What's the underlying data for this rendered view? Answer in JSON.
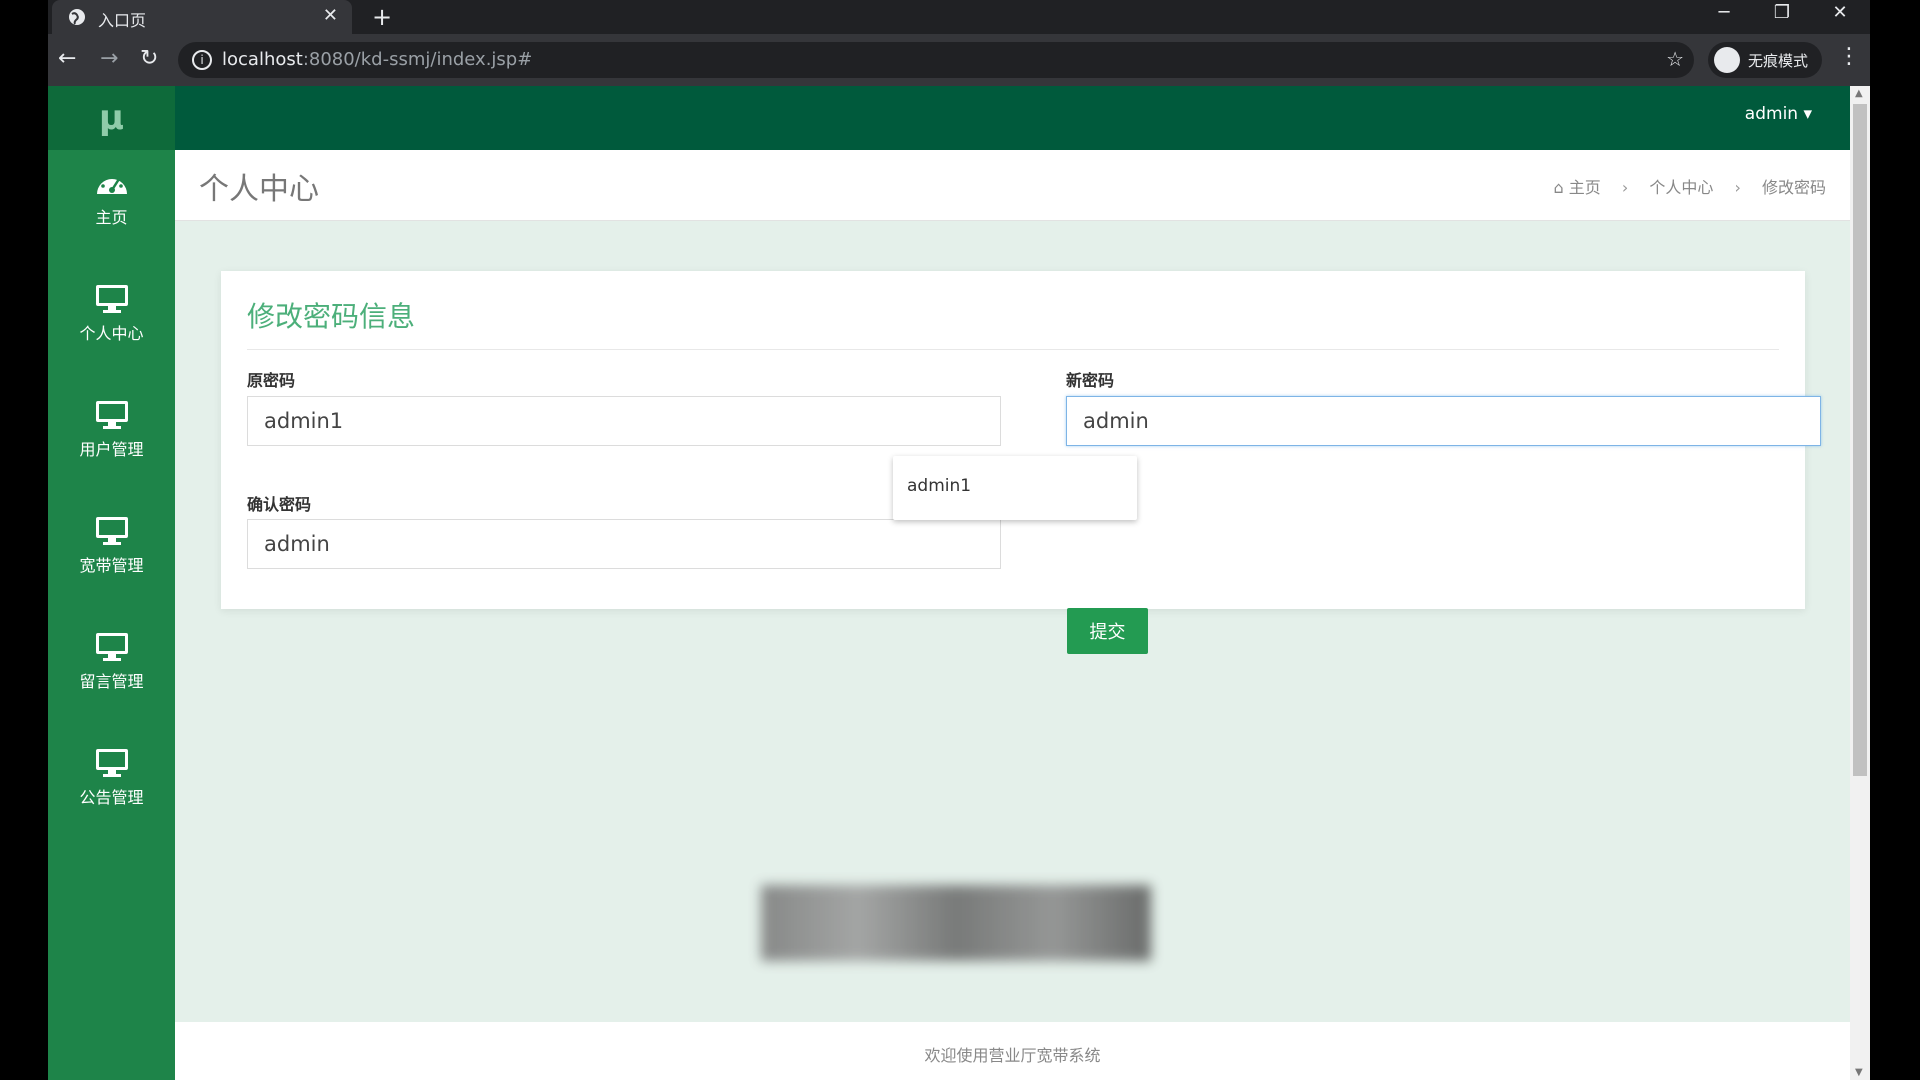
{
  "browser": {
    "tab_title": "入口页",
    "url_host": "localhost",
    "url_path": ":8080/kd-ssmj/index.jsp#",
    "incognito_label": "无痕模式"
  },
  "app": {
    "logo": "μ",
    "user": "admin ▾",
    "sidebar": {
      "items": [
        {
          "label": "主页",
          "icon": "dashboard-icon"
        },
        {
          "label": "个人中心",
          "icon": "monitor-icon"
        },
        {
          "label": "用户管理",
          "icon": "monitor-icon"
        },
        {
          "label": "宽带管理",
          "icon": "monitor-icon"
        },
        {
          "label": "留言管理",
          "icon": "monitor-icon"
        },
        {
          "label": "公告管理",
          "icon": "monitor-icon"
        }
      ]
    },
    "page_title": "个人中心",
    "breadcrumb": [
      "主页",
      "个人中心",
      "修改密码"
    ],
    "form": {
      "title": "修改密码信息",
      "old_label": "原密码",
      "old_value": "admin1",
      "new_label": "新密码",
      "new_value": "admin",
      "confirm_label": "确认密码",
      "confirm_value": "admin",
      "autocomplete_option": "admin1",
      "submit_label": "提交"
    },
    "footer": "欢迎使用营业厅宽带系统"
  },
  "colors": {
    "sidebar": "#1e8449",
    "topbar": "#005a3c",
    "accent": "#239b52"
  }
}
